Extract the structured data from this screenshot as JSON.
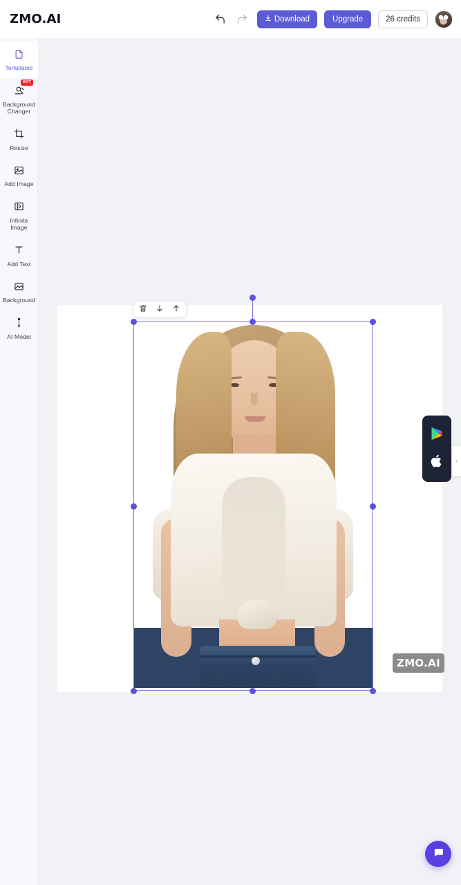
{
  "header": {
    "brand": "ZMO.AI",
    "undo_icon": "undo-icon",
    "redo_icon": "redo-icon",
    "download_label": "Download",
    "download_icon": "download-icon",
    "upgrade_label": "Upgrade",
    "credits_label": "26 credits",
    "avatar_alt": "user-avatar",
    "accent_color": "#5b5bd6"
  },
  "sidebar": {
    "items": [
      {
        "label": "Templates",
        "icon": "templates-icon",
        "active": true,
        "badge": ""
      },
      {
        "label": "Background Changer",
        "icon": "background-changer-icon",
        "active": false,
        "badge": "HOT"
      },
      {
        "label": "Resize",
        "icon": "resize-icon",
        "active": false,
        "badge": ""
      },
      {
        "label": "Add Image",
        "icon": "add-image-icon",
        "active": false,
        "badge": ""
      },
      {
        "label": "Infinite Image",
        "icon": "infinite-image-icon",
        "active": false,
        "badge": ""
      },
      {
        "label": "Add Text",
        "icon": "add-text-icon",
        "active": false,
        "badge": ""
      },
      {
        "label": "Background",
        "icon": "background-icon",
        "active": false,
        "badge": ""
      },
      {
        "label": "AI Model",
        "icon": "ai-model-icon",
        "active": false,
        "badge": ""
      }
    ]
  },
  "canvas": {
    "watermark": "ZMO.AI",
    "selection_color": "#5b52d6",
    "toolbar": {
      "delete_icon": "trash-icon",
      "send_backward_icon": "arrow-down-icon",
      "bring_forward_icon": "arrow-up-icon"
    }
  },
  "store_panel": {
    "google_play": "google-play-icon",
    "app_store": "apple-icon",
    "background_color": "#1e2235"
  },
  "panels": {
    "left_toggle_glyph": "›",
    "right_toggle_glyph": "‹"
  },
  "chat": {
    "icon": "chat-bubble-icon",
    "color": "#5b3fe0"
  }
}
